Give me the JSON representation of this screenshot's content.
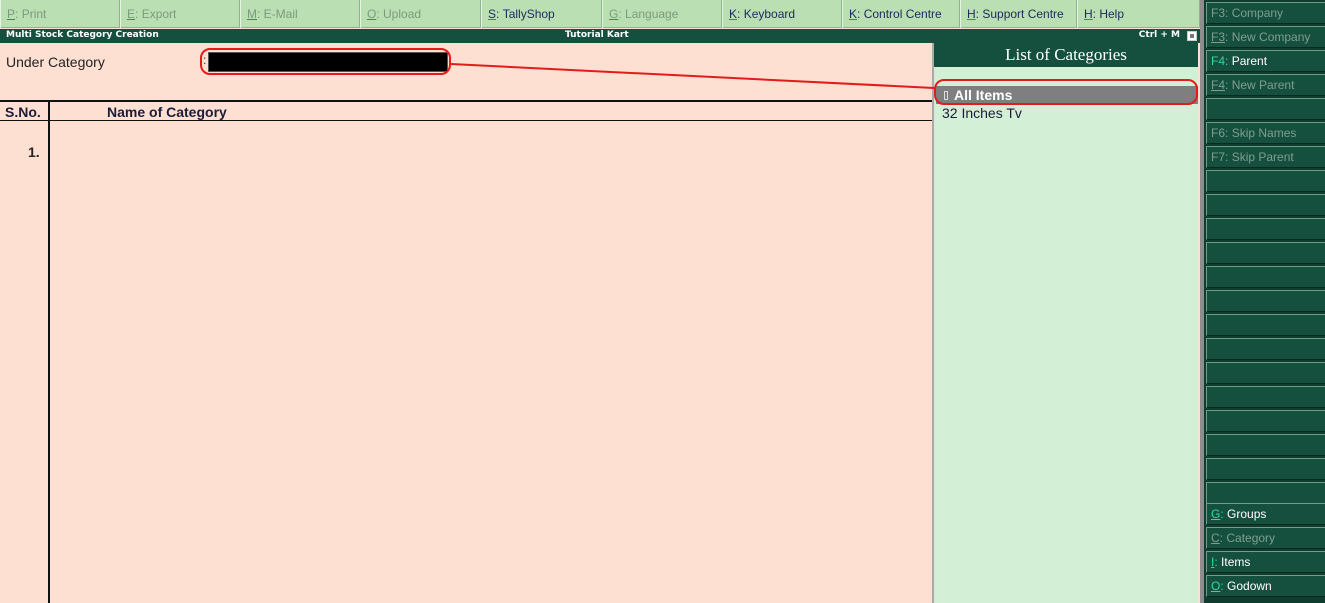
{
  "top_menu": [
    {
      "key": "P",
      "label": "Print",
      "enabled": false
    },
    {
      "key": "E",
      "label": "Export",
      "enabled": false
    },
    {
      "key": "M",
      "label": "E-Mail",
      "enabled": false
    },
    {
      "key": "O",
      "label": "Upload",
      "enabled": false
    },
    {
      "key": "S",
      "label": "TallyShop",
      "enabled": true
    },
    {
      "key": "G",
      "label": "Language",
      "enabled": false
    },
    {
      "key": "K",
      "label": "Keyboard",
      "enabled": true
    },
    {
      "key": "K",
      "label": "Control Centre",
      "enabled": true
    },
    {
      "key": "H",
      "label": "Support Centre",
      "enabled": true
    },
    {
      "key": "H",
      "label": "Help",
      "enabled": true
    }
  ],
  "title_bar": {
    "screen_title": "Multi Stock Category  Creation",
    "company": "Tutorial Kart",
    "shortcut": "Ctrl + M"
  },
  "form": {
    "under_category_label": "Under Category",
    "under_category_colon": ":",
    "under_category_value": "",
    "col_sno": "S.No.",
    "col_name": "Name of Category",
    "first_row_sno": "1."
  },
  "list_panel": {
    "title": "List of Categories",
    "items": [
      {
        "label": "All Items",
        "selected": true
      },
      {
        "label": "32 Inches Tv",
        "selected": false
      }
    ]
  },
  "side_buttons": {
    "f3_company": {
      "key": "F3",
      "label": "Company",
      "enabled": false
    },
    "f3_new_company": {
      "key": "F3",
      "label": "New Company",
      "enabled": false
    },
    "f4_parent": {
      "key": "F4",
      "label": "Parent",
      "enabled": true
    },
    "f4_new_parent": {
      "key": "F4",
      "label": "New Parent",
      "enabled": false
    },
    "f6_skip_names": {
      "key": "F6",
      "label": "Skip Names",
      "enabled": false
    },
    "f7_skip_parent": {
      "key": "F7",
      "label": "Skip Parent",
      "enabled": false
    },
    "groups": {
      "key": "G",
      "label": "Groups",
      "enabled": true
    },
    "category": {
      "key": "C",
      "label": "Category",
      "enabled": false
    },
    "items": {
      "key": "I",
      "label": "Items",
      "enabled": true
    },
    "godown": {
      "key": "O",
      "label": "Godown",
      "enabled": true
    }
  },
  "colors": {
    "accent_dark_green": "#15503f",
    "menu_green": "#b9dfb3",
    "form_bg": "#fde0d2",
    "list_bg": "#d3f0d6",
    "annotation_red": "#e31b1b"
  }
}
